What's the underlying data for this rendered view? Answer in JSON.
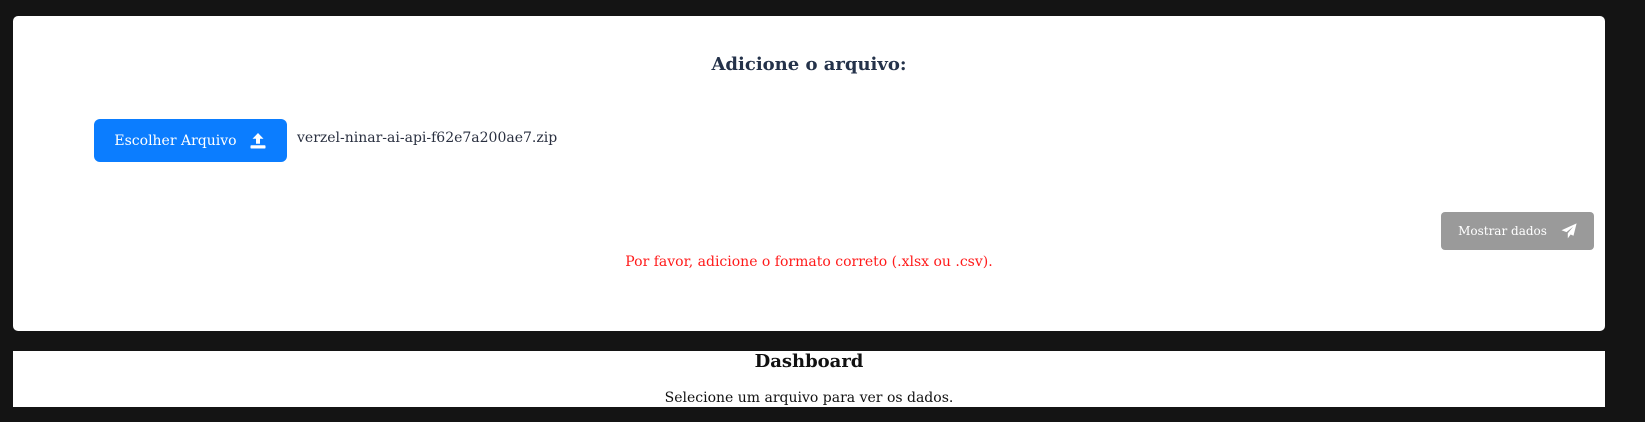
{
  "upload": {
    "title": "Adicione o arquivo:",
    "choose_button_label": "Escolher Arquivo",
    "choose_button_icon": "upload-icon",
    "file_name": "verzel-ninar-ai-api-f62e7a200ae7.zip",
    "submit_button_label": "Mostrar dados",
    "submit_button_icon": "paper-plane-icon",
    "error_message": "Por favor, adicione o formato correto (.xlsx ou .csv).",
    "colors": {
      "primary": "#0b7dff",
      "disabled": "#9a9a9a",
      "error": "#ff1a1a"
    }
  },
  "dashboard": {
    "title": "Dashboard",
    "empty_message": "Selecione um arquivo para ver os dados."
  }
}
